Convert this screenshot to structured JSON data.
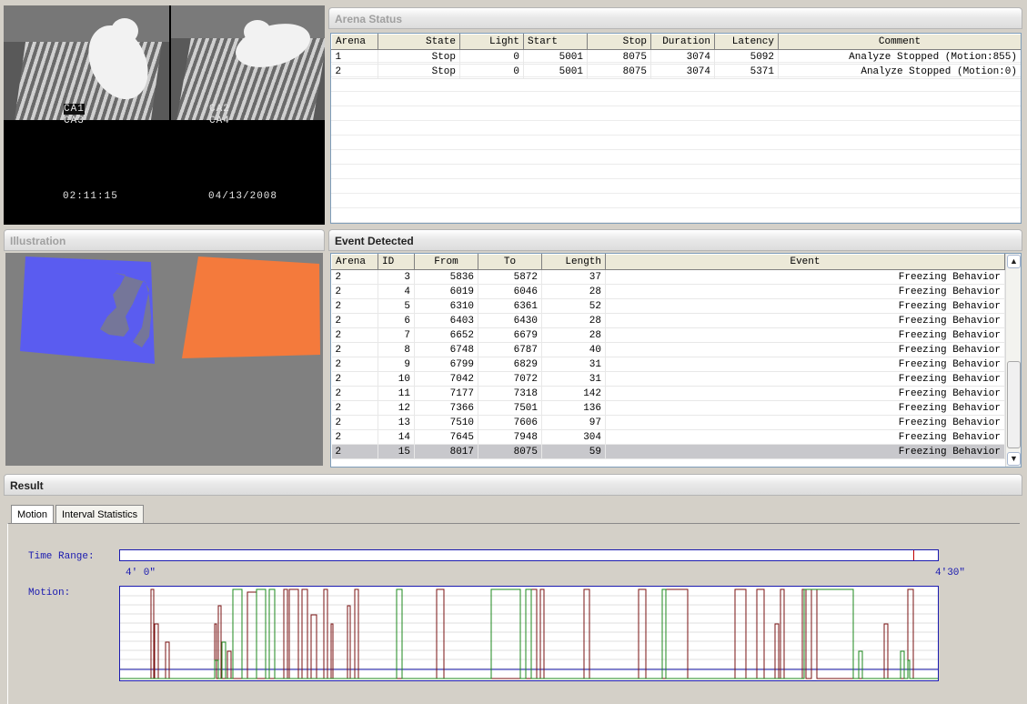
{
  "camera": {
    "labels": [
      "CA1",
      "CA2",
      "CA3",
      "CA4"
    ],
    "time": "02:11:15",
    "date": "04/13/2008"
  },
  "arena_status": {
    "title": "Arena Status",
    "columns": [
      "Arena",
      "State",
      "Light",
      "Start",
      "Stop",
      "Duration",
      "Latency",
      "Comment"
    ],
    "rows": [
      [
        "1",
        "Stop",
        "0",
        "5001",
        "8075",
        "3074",
        "5092",
        "Analyze Stopped (Motion:855)"
      ],
      [
        "2",
        "Stop",
        "0",
        "5001",
        "8075",
        "3074",
        "5371",
        "Analyze Stopped (Motion:0)"
      ]
    ]
  },
  "illustration": {
    "title": "Illustration",
    "colors": {
      "left_arena": "#5a5cf0",
      "right_arena": "#f47a3c",
      "background": "#808080"
    }
  },
  "events": {
    "title": "Event Detected",
    "columns": [
      "Arena",
      "ID",
      "From",
      "To",
      "Length",
      "Event"
    ],
    "rows": [
      [
        "2",
        "3",
        "5836",
        "5872",
        "37",
        "Freezing Behavior"
      ],
      [
        "2",
        "4",
        "6019",
        "6046",
        "28",
        "Freezing Behavior"
      ],
      [
        "2",
        "5",
        "6310",
        "6361",
        "52",
        "Freezing Behavior"
      ],
      [
        "2",
        "6",
        "6403",
        "6430",
        "28",
        "Freezing Behavior"
      ],
      [
        "2",
        "7",
        "6652",
        "6679",
        "28",
        "Freezing Behavior"
      ],
      [
        "2",
        "8",
        "6748",
        "6787",
        "40",
        "Freezing Behavior"
      ],
      [
        "2",
        "9",
        "6799",
        "6829",
        "31",
        "Freezing Behavior"
      ],
      [
        "2",
        "10",
        "7042",
        "7072",
        "31",
        "Freezing Behavior"
      ],
      [
        "2",
        "11",
        "7177",
        "7318",
        "142",
        "Freezing Behavior"
      ],
      [
        "2",
        "12",
        "7366",
        "7501",
        "136",
        "Freezing Behavior"
      ],
      [
        "2",
        "13",
        "7510",
        "7606",
        "97",
        "Freezing Behavior"
      ],
      [
        "2",
        "14",
        "7645",
        "7948",
        "304",
        "Freezing Behavior"
      ],
      [
        "2",
        "15",
        "8017",
        "8075",
        "59",
        "Freezing Behavior"
      ]
    ],
    "selected_index": 12
  },
  "result": {
    "title": "Result",
    "tabs": [
      "Motion",
      "Interval Statistics"
    ],
    "active_tab": 0,
    "time_range_label": "Time Range:",
    "time_start": "4' 0\"",
    "time_end": "4'30\"",
    "time_range_marker": 0.97,
    "motion_label": "Motion:",
    "colors": {
      "arena1": "#7a1010",
      "arena2": "#1c8a1c",
      "axis": "#1a1ab0",
      "gridline": "#c0c0c0"
    }
  }
}
